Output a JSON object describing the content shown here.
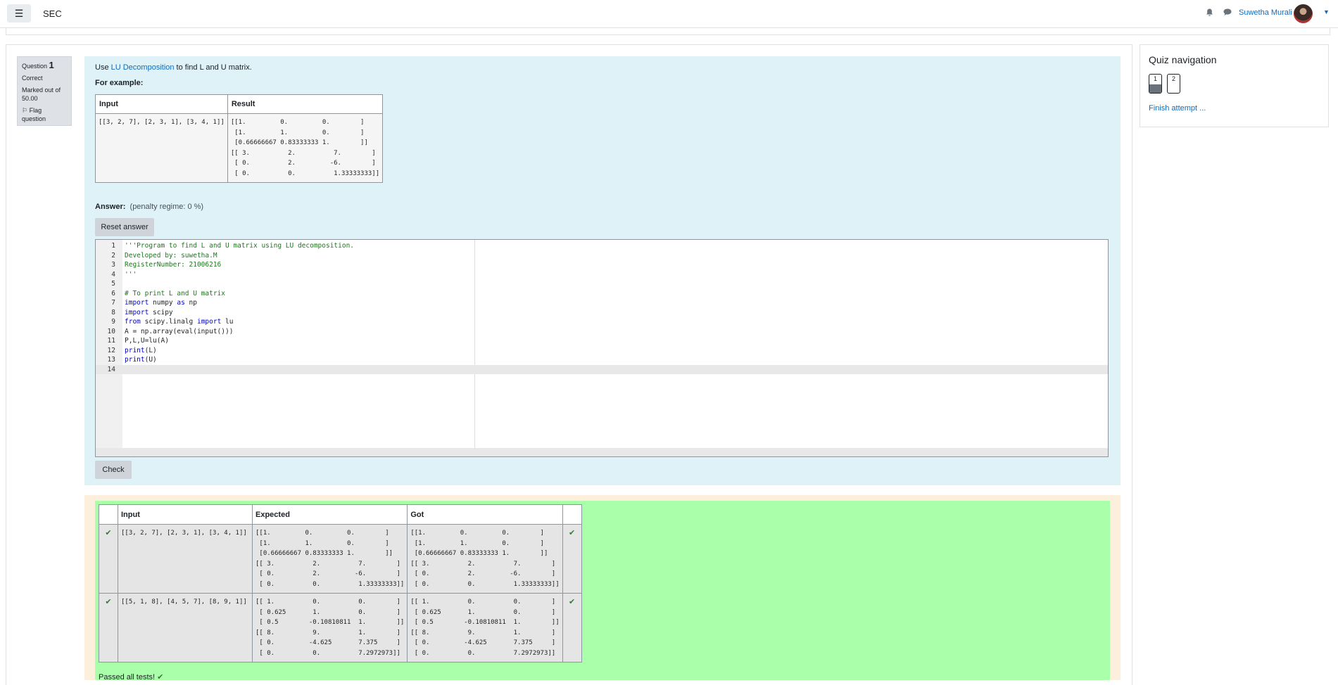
{
  "navbar": {
    "menu_icon": "☰",
    "site_name": "SEC",
    "bell_icon": "🔔",
    "chat_icon": "💬",
    "user_name": "Suwetha Murali",
    "caret": "▼"
  },
  "question_info": {
    "label": "Question",
    "number": "1",
    "state": "Correct",
    "marked": "Marked out of 50.00",
    "flag": "Flag question"
  },
  "question": {
    "text_prefix": "Use ",
    "link_text": "LU Decomposition",
    "text_suffix": " to find L and U matrix.",
    "for_example": "For example:",
    "example_headers": [
      "Input",
      "Result"
    ],
    "example_input": "[[3, 2, 7], [2, 3, 1], [3, 4, 1]]",
    "example_result": "[[1.         0.         0.        ]\n [1.         1.         0.        ]\n [0.66666667 0.83333333 1.        ]]\n[[ 3.          2.          7.        ]\n [ 0.          2.         -6.        ]\n [ 0.          0.          1.33333333]]",
    "answer_label": "Answer:",
    "penalty": "(penalty regime: 0 %)",
    "reset_button": "Reset answer",
    "check_button": "Check"
  },
  "code": {
    "line_numbers": [
      "1",
      "2",
      "3",
      "4",
      "5",
      "6",
      "7",
      "8",
      "9",
      "10",
      "11",
      "12",
      "13",
      "14"
    ],
    "l1": "'''Program to find L and U matrix using LU decomposition.",
    "l2": "Developed by: suwetha.M",
    "l3": "RegisterNumber: 21006216",
    "l4": "'''",
    "l5": "",
    "l6": "# To print L and U matrix",
    "l7_kw1": "import",
    "l7_rest": " numpy ",
    "l7_kw2": "as",
    "l7_end": " np",
    "l8_kw": "import",
    "l8_rest": " scipy",
    "l9_kw1": "from",
    "l9_rest": " scipy.linalg ",
    "l9_kw2": "import",
    "l9_end": " lu",
    "l10": "A = np.array(eval(input()))",
    "l11": "P,L,U=lu(A)",
    "l12_kw": "print",
    "l12_rest": "(L)",
    "l13_kw": "print",
    "l13_rest": "(U)",
    "l14": ""
  },
  "results": {
    "headers": [
      "Input",
      "Expected",
      "Got"
    ],
    "rows": [
      {
        "input": "[[3, 2, 7], [2, 3, 1], [3, 4, 1]]",
        "expected": "[[1.         0.         0.        ]\n [1.         1.         0.        ]\n [0.66666667 0.83333333 1.        ]]\n[[ 3.          2.          7.        ]\n [ 0.          2.         -6.        ]\n [ 0.          0.          1.33333333]]",
        "got": "[[1.         0.         0.        ]\n [1.         1.         0.        ]\n [0.66666667 0.83333333 1.        ]]\n[[ 3.          2.          7.        ]\n [ 0.          2.         -6.        ]\n [ 0.          0.          1.33333333]]"
      },
      {
        "input": "[[5, 1, 8], [4, 5, 7], [8, 9, 1]]",
        "expected": "[[ 1.          0.          0.        ]\n [ 0.625       1.          0.        ]\n [ 0.5        -0.10810811  1.        ]]\n[[ 8.          9.          1.        ]\n [ 0.         -4.625       7.375     ]\n [ 0.          0.          7.2972973]]",
        "got": "[[ 1.          0.          0.        ]\n [ 0.625       1.          0.        ]\n [ 0.5        -0.10810811  1.        ]]\n[[ 8.          9.          1.        ]\n [ 0.         -4.625       7.375     ]\n [ 0.          0.          7.2972973]]"
      }
    ],
    "tick": "✔",
    "passed": "Passed all tests!"
  },
  "quiz_nav": {
    "title": "Quiz navigation",
    "buttons": [
      "1",
      "2"
    ],
    "finish": "Finish attempt ..."
  },
  "colors": {
    "link": "#0f6cbf",
    "formulation_bg": "#def2f8",
    "pass_bg": "#aaffaa",
    "outcome_bg": "#fcefdc",
    "tick": "#357a32"
  }
}
